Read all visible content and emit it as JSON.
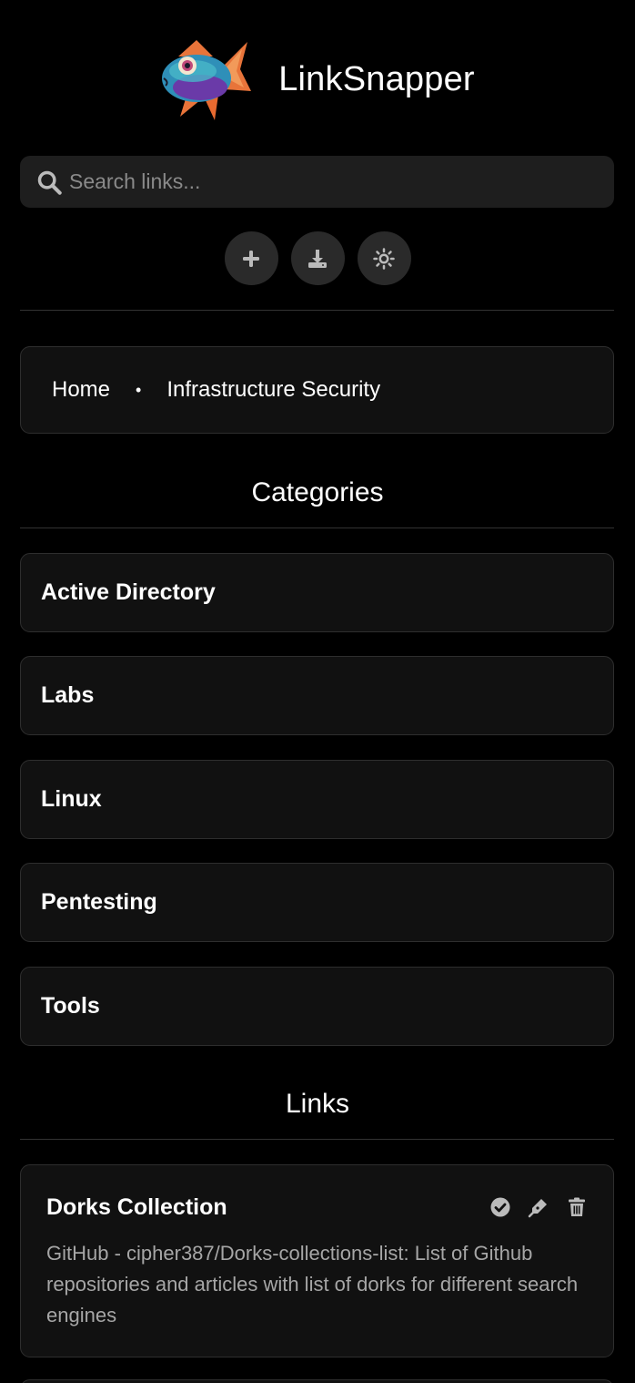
{
  "app": {
    "title": "LinkSnapper"
  },
  "search": {
    "placeholder": "Search links..."
  },
  "breadcrumb": {
    "home": "Home",
    "separator": "•",
    "current": "Infrastructure Security"
  },
  "sections": {
    "categories": "Categories",
    "links": "Links"
  },
  "categories": [
    "Active Directory",
    "Labs",
    "Linux",
    "Pentesting",
    "Tools"
  ],
  "links": [
    {
      "title": "Dorks Collection",
      "description": "GitHub - cipher387/Dorks-collections-list: List of Github repositories and articles with list of dorks for different search engines"
    }
  ],
  "colors": {
    "background": "#000000",
    "card": "#111111",
    "input": "#1e1e1e",
    "button": "#2a2a2a",
    "muted_text": "#a6a6a6",
    "icon": "#bbbbbb"
  }
}
